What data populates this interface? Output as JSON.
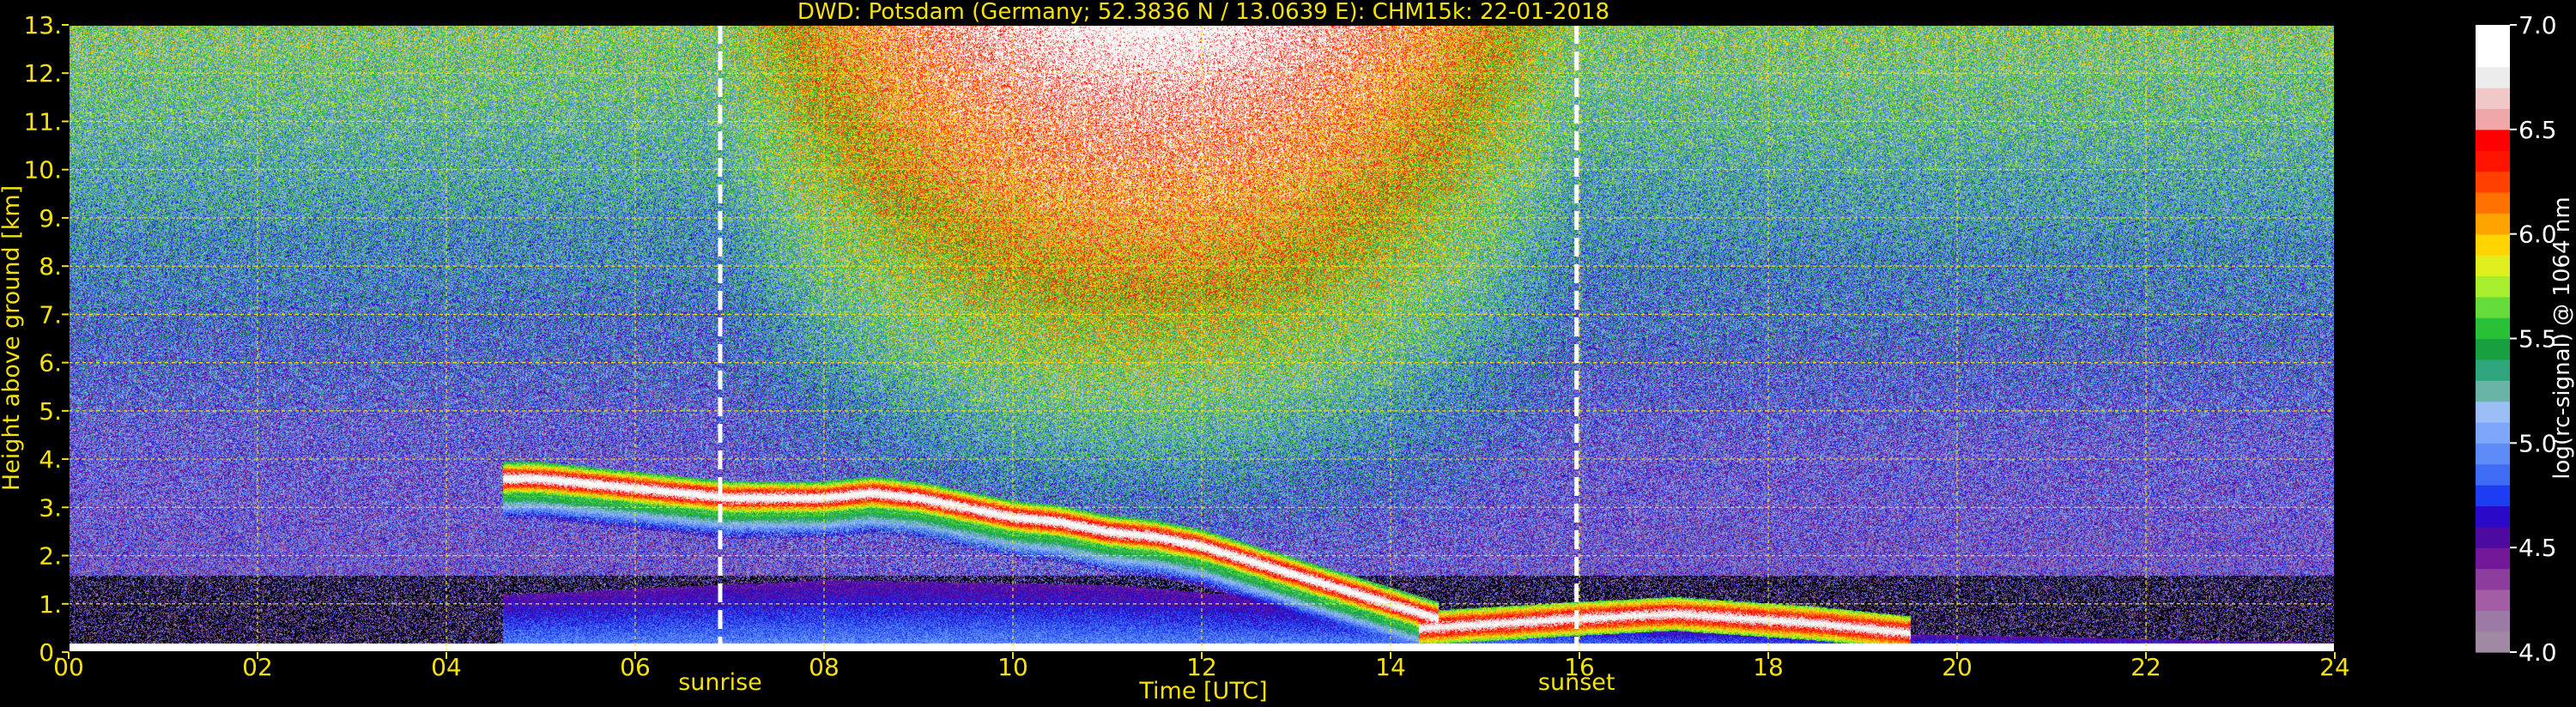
{
  "chart_data": {
    "type": "heatmap",
    "title": "DWD: Potsdam (Germany; 52.3836 N / 13.0639 E):    CHM15k: 22-01-2018",
    "xlabel": "Time [UTC]",
    "ylabel": "Height above ground [km]",
    "xlim": [
      0,
      24
    ],
    "ylim": [
      0,
      13
    ],
    "x_ticks": [
      "00",
      "02",
      "04",
      "06",
      "08",
      "10",
      "12",
      "14",
      "16",
      "18",
      "20",
      "22",
      "24"
    ],
    "x_tick_values": [
      0,
      2,
      4,
      6,
      8,
      10,
      12,
      14,
      16,
      18,
      20,
      22,
      24
    ],
    "y_ticks": [
      "0.",
      "1.",
      "2.",
      "3.",
      "4.",
      "5.",
      "6.",
      "7.",
      "8.",
      "9.",
      "10.",
      "11.",
      "12.",
      "13."
    ],
    "y_tick_values": [
      0,
      1,
      2,
      3,
      4,
      5,
      6,
      7,
      8,
      9,
      10,
      11,
      12,
      13
    ],
    "grid": true,
    "grid_color": "#f5e10f",
    "text_color": "#f5e10f",
    "background": "#000000",
    "markers": [
      {
        "name": "sunrise",
        "x": 6.9
      },
      {
        "name": "sunset",
        "x": 15.97
      }
    ],
    "colorbar": {
      "label": "log(rc-signal) @ 1064 nm",
      "range": [
        4.0,
        7.0
      ],
      "ticks": [
        "4.0",
        "4.5",
        "5.0",
        "5.5",
        "6.0",
        "6.5",
        "7.0"
      ],
      "tick_values": [
        4.0,
        4.5,
        5.0,
        5.5,
        6.0,
        6.5,
        7.0
      ],
      "colors": [
        "#a08aa3",
        "#9b7aa6",
        "#a25da5",
        "#8b3c9c",
        "#74189a",
        "#4c0aa0",
        "#2a0ac8",
        "#1e3cf2",
        "#3f6cf4",
        "#5d8bf8",
        "#7ea6fb",
        "#9bbef7",
        "#69b3a7",
        "#2fa57d",
        "#18a040",
        "#27c037",
        "#63dc3b",
        "#a6ee2e",
        "#dfee1c",
        "#ffd400",
        "#ffa300",
        "#ff7200",
        "#ff4000",
        "#ff1400",
        "#ff0000",
        "#efa7a7",
        "#f0c8c8",
        "#ececec",
        "#ffffff",
        "#ffffff"
      ]
    },
    "features": [
      {
        "kind": "cloud_layer",
        "x": [
          4.6,
          5.0,
          5.5,
          6.0,
          6.5,
          7.0,
          7.5,
          8.0,
          8.5,
          9.0,
          9.5,
          10.0,
          10.5,
          11.0,
          11.5,
          12.0,
          12.5,
          13.0,
          13.5,
          14.0,
          14.5
        ],
        "y": [
          3.6,
          3.6,
          3.5,
          3.4,
          3.3,
          3.2,
          3.2,
          3.2,
          3.3,
          3.2,
          3.0,
          2.8,
          2.7,
          2.5,
          2.4,
          2.2,
          1.9,
          1.6,
          1.3,
          1.0,
          0.7
        ],
        "thickness": 0.35
      },
      {
        "kind": "boundary_layer_aerosol",
        "x": [
          4.7,
          8.0,
          11.0,
          13.5,
          16.0,
          19.0,
          24.0
        ],
        "top": [
          1.2,
          1.5,
          1.4,
          1.0,
          0.6,
          0.4,
          0.2
        ]
      },
      {
        "kind": "low_cloud",
        "x": [
          14.3,
          16.0,
          17.0,
          18.5,
          19.5
        ],
        "y": [
          0.5,
          0.7,
          0.8,
          0.6,
          0.4
        ]
      }
    ]
  }
}
